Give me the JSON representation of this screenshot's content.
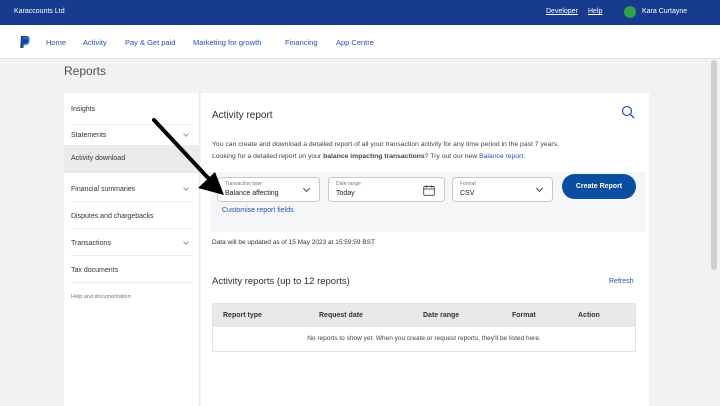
{
  "topbar": {
    "company": "Karaccounts Ltd",
    "developer": "Developer",
    "help": "Help",
    "user": "Kara Curtayne"
  },
  "nav": {
    "items": [
      "Home",
      "Activity",
      "Pay & Get paid",
      "Marketing for growth",
      "Financing",
      "App Centre"
    ]
  },
  "page": {
    "title": "Reports"
  },
  "sidebar": {
    "items": [
      {
        "label": "Insights"
      },
      {
        "label": "Statements"
      },
      {
        "label": "Activity download"
      },
      {
        "label": "Financial summaries"
      },
      {
        "label": "Disputes and chargebacks"
      },
      {
        "label": "Transactions"
      },
      {
        "label": "Tax documents"
      },
      {
        "label": "Help and documentation"
      }
    ]
  },
  "main": {
    "title": "Activity report",
    "desc1": "You can create and download a detailed report of all your transaction activity for any time period in the past 7 years.",
    "desc2_pre": "Looking for a detailed report on your ",
    "desc2_bold": "balance impacting transactions",
    "desc2_mid": "? Try out our new ",
    "desc2_link": "Balance report",
    "desc2_end": ".",
    "fields": {
      "transaction_type": {
        "label": "Transaction type",
        "value": "Balance affecting"
      },
      "date_range": {
        "label": "Date range",
        "value": "Today"
      },
      "format": {
        "label": "Format",
        "value": "CSV"
      }
    },
    "create_button": "Create Report",
    "customise": "Customise report fields",
    "updated": "Data will be updated as of 15 May 2023 at 15:59:59 BST",
    "reports_title": "Activity reports (up to 12 reports)",
    "refresh": "Refresh",
    "table": {
      "headers": [
        "Report type",
        "Request date",
        "Date range",
        "Format",
        "Action"
      ],
      "empty": "No reports to show yet. When you create or request reports, they'll be listed here."
    }
  },
  "colors": {
    "topbar": "#173c8f",
    "accent": "#0a4ea1",
    "link": "#1f53b8"
  }
}
